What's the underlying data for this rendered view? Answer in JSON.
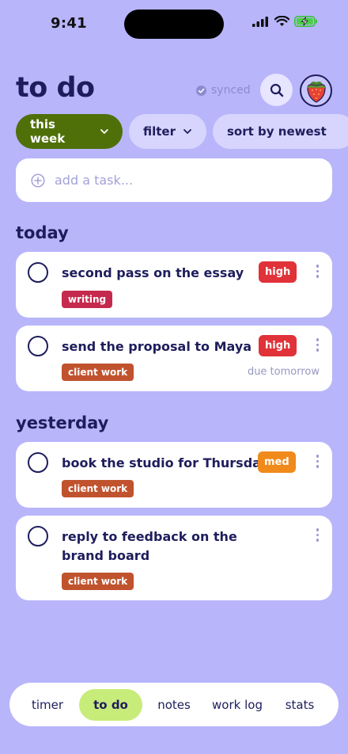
{
  "status_bar": {
    "time": "9:41",
    "icons": [
      "signal-icon",
      "wifi-icon",
      "battery-charging-icon"
    ]
  },
  "header": {
    "title": "to do",
    "sync_label": "synced",
    "search_icon": "search-icon",
    "avatar_icon": "strawberry-icon"
  },
  "chips": {
    "week_label": "this week",
    "filter_label": "filter",
    "sort_label": "sort by newest"
  },
  "add_task": {
    "placeholder": "add a task..."
  },
  "sections": [
    {
      "title": "today",
      "tasks": [
        {
          "title": "second pass on the essay",
          "priority": "high",
          "tag": "writing",
          "due": ""
        },
        {
          "title": "send the proposal to Maya",
          "priority": "high",
          "tag": "client work",
          "due": "due tomorrow"
        }
      ]
    },
    {
      "title": "yesterday",
      "tasks": [
        {
          "title": "book the studio for Thursday",
          "priority": "med",
          "tag": "client work",
          "due": ""
        },
        {
          "title": "reply to feedback on the brand board",
          "priority": "",
          "tag": "client work",
          "due": ""
        }
      ]
    }
  ],
  "bottom_nav": {
    "items": [
      "timer",
      "to do",
      "notes",
      "work log",
      "stats"
    ],
    "active": "to do"
  },
  "colors": {
    "background": "#b8b5fb",
    "primary_text": "#1e1d5c",
    "chip_active": "#4f7008",
    "nav_active": "#c8ec7a",
    "priority_high": "#e03238",
    "priority_med": "#f08a1a",
    "tag_writing": "#c52a4e",
    "tag_client_work": "#c0532e"
  }
}
